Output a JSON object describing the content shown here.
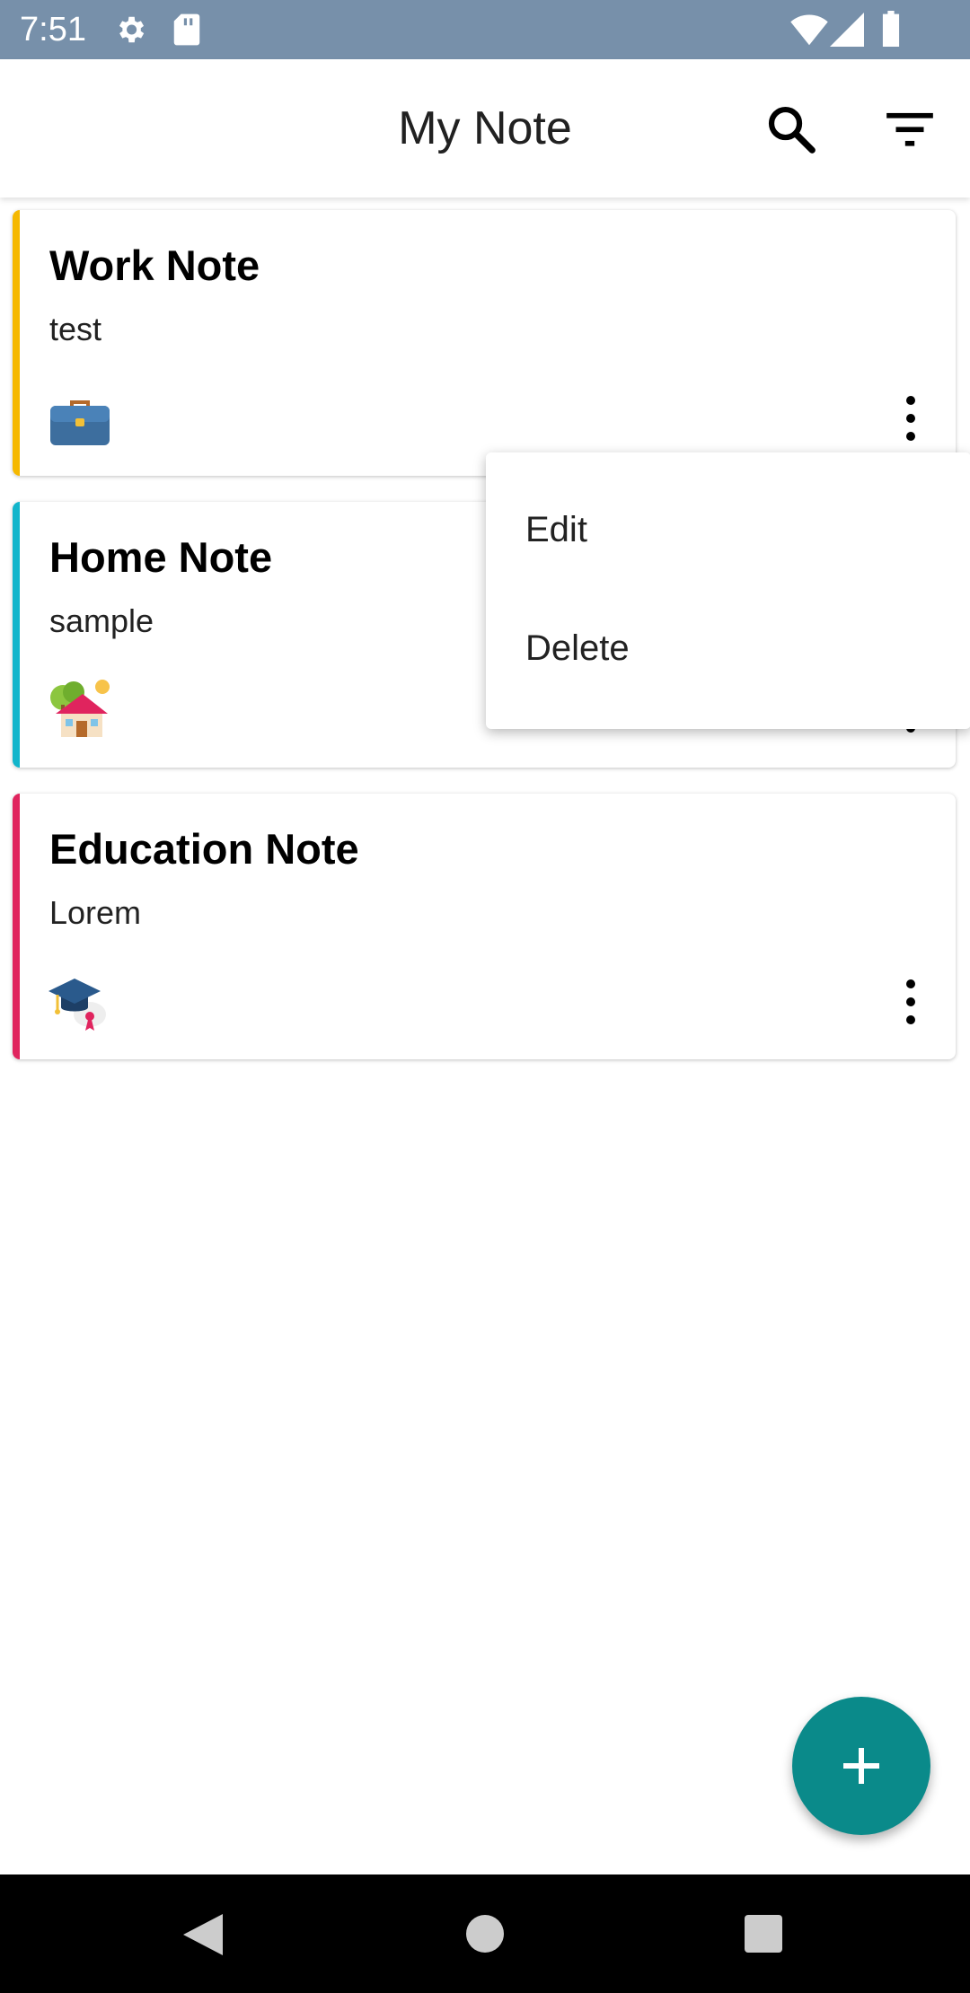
{
  "status_bar": {
    "time": "7:51"
  },
  "app_bar": {
    "title": "My Note"
  },
  "colors": {
    "status_bar": "#7790aa",
    "work_accent": "#f5b800",
    "home_accent": "#12b5cb",
    "education_accent": "#e0245e",
    "fab": "#0a8a8a"
  },
  "notes": [
    {
      "title": "Work Note",
      "description": "test",
      "icon": "briefcase-icon"
    },
    {
      "title": "Home Note",
      "description": "sample",
      "icon": "house-icon"
    },
    {
      "title": "Education Note",
      "description": "Lorem",
      "icon": "graduation-cap-icon"
    }
  ],
  "popup_menu": {
    "items": [
      {
        "label": "Edit"
      },
      {
        "label": "Delete"
      }
    ]
  }
}
